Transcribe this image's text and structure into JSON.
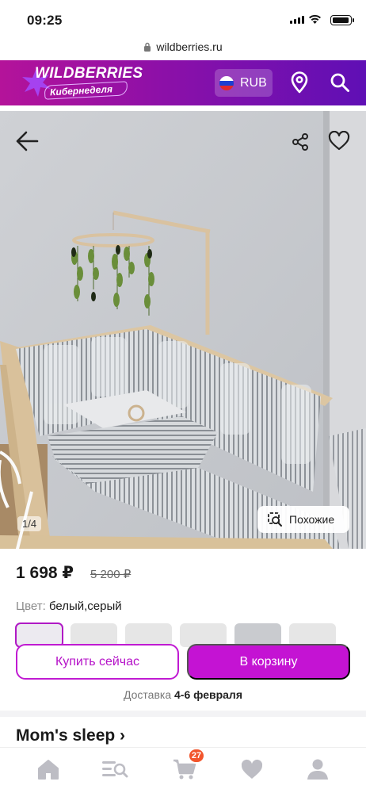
{
  "status_bar": {
    "time": "09:25"
  },
  "browser": {
    "url": "wildberries.ru"
  },
  "header": {
    "logo": "WILDBERRIES",
    "logo_sub": "Кибернеделя",
    "currency": "RUB",
    "colors": {
      "gradient_start": "#b4139a",
      "gradient_end": "#5f0fb5"
    },
    "icons": [
      "location-pin-icon",
      "search-icon"
    ]
  },
  "gallery": {
    "counter": "1/4",
    "similar_label": "Похожие",
    "icons": [
      "back-arrow-icon",
      "share-icon",
      "heart-icon",
      "similar-search-icon"
    ]
  },
  "product": {
    "price": "1 698 ₽",
    "old_price": "5 200 ₽",
    "color_label": "Цвет:",
    "color_value": "белый,серый",
    "swatch_count": 6,
    "buy_now_label": "Купить сейчас",
    "add_to_cart_label": "В корзину",
    "delivery_label": "Доставка",
    "delivery_dates": "4-6 февраля",
    "brand": "Mom's sleep",
    "accent_color": "#c413d3"
  },
  "bottom_nav": {
    "items": [
      "home-icon",
      "catalog-icon",
      "cart-icon",
      "favorites-icon",
      "profile-icon"
    ],
    "cart_badge": "27"
  }
}
